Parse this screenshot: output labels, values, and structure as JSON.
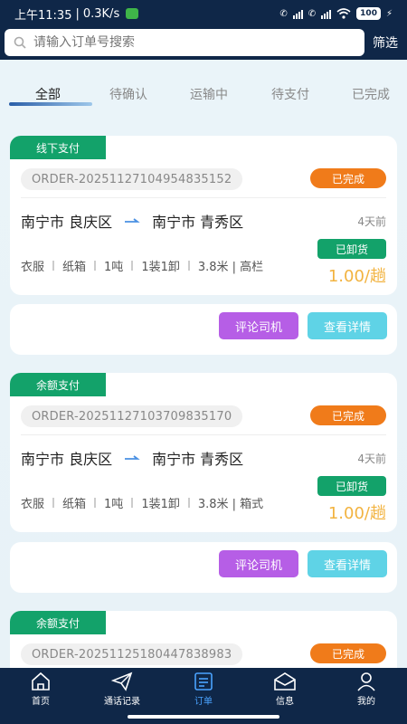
{
  "status_bar": {
    "time": "上午11:35",
    "speed": "0.3K/s",
    "battery": "100"
  },
  "search": {
    "placeholder": "请输入订单号搜索",
    "filter_label": "筛选"
  },
  "tabs": [
    {
      "label": "全部",
      "active": true
    },
    {
      "label": "待确认"
    },
    {
      "label": "运输中"
    },
    {
      "label": "待支付"
    },
    {
      "label": "已完成"
    }
  ],
  "orders": [
    {
      "pay_type": "线下支付",
      "order_no": "ORDER-20251127104954835152",
      "status": "已完成",
      "from": "南宁市 良庆区",
      "to": "南宁市 青秀区",
      "time_ago": "4天前",
      "specs": [
        "衣服",
        "纸箱",
        "1吨",
        "1装1卸",
        "3.8米 | 高栏"
      ],
      "unload_status": "已卸货",
      "price": "1.00/趟"
    },
    {
      "pay_type": "余额支付",
      "order_no": "ORDER-20251127103709835170",
      "status": "已完成",
      "from": "南宁市 良庆区",
      "to": "南宁市 青秀区",
      "time_ago": "4天前",
      "specs": [
        "衣服",
        "纸箱",
        "1吨",
        "1装1卸",
        "3.8米 | 箱式"
      ],
      "unload_status": "已卸货",
      "price": "1.00/趟"
    },
    {
      "pay_type": "余额支付",
      "order_no": "ORDER-20251125180447838983",
      "status": "已完成"
    }
  ],
  "actions": {
    "review_label": "评论司机",
    "detail_label": "查看详情"
  },
  "colors": {
    "header_bg": "#0f2748",
    "green": "#13a26a",
    "orange": "#f07b1a",
    "purple": "#b65ee6",
    "cyan": "#5fd3e6",
    "price": "#f2b340",
    "nav_active": "#4aa3ff"
  },
  "nav": [
    {
      "label": "首页",
      "icon": "home-icon"
    },
    {
      "label": "通话记录",
      "icon": "paper-plane-icon"
    },
    {
      "label": "订单",
      "icon": "order-list-icon",
      "active": true
    },
    {
      "label": "信息",
      "icon": "envelope-icon"
    },
    {
      "label": "我的",
      "icon": "user-icon"
    }
  ]
}
